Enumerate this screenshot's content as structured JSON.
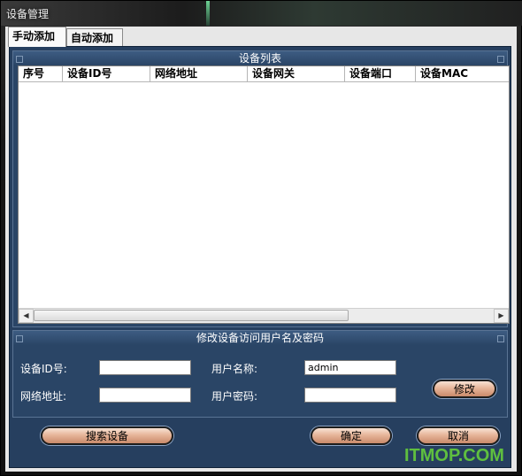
{
  "window": {
    "title": "设备管理"
  },
  "tabs": [
    {
      "label": "手动添加"
    },
    {
      "label": "自动添加"
    }
  ],
  "device_list": {
    "title": "设备列表",
    "columns": [
      "序号",
      "设备ID号",
      "网络地址",
      "设备网关",
      "设备端口",
      "设备MAC"
    ],
    "rows": []
  },
  "credentials": {
    "title": "修改设备访问用户名及密码",
    "device_id_label": "设备ID号:",
    "device_id_value": "",
    "ip_label": "网络地址:",
    "ip_value": "",
    "username_label": "用户名称:",
    "username_value": "admin",
    "password_label": "用户密码:",
    "password_value": "",
    "modify_button": "修改"
  },
  "footer": {
    "search_button": "搜索设备",
    "ok_button": "确定",
    "cancel_button": "取消"
  },
  "watermark": "ITMOP.COM"
}
